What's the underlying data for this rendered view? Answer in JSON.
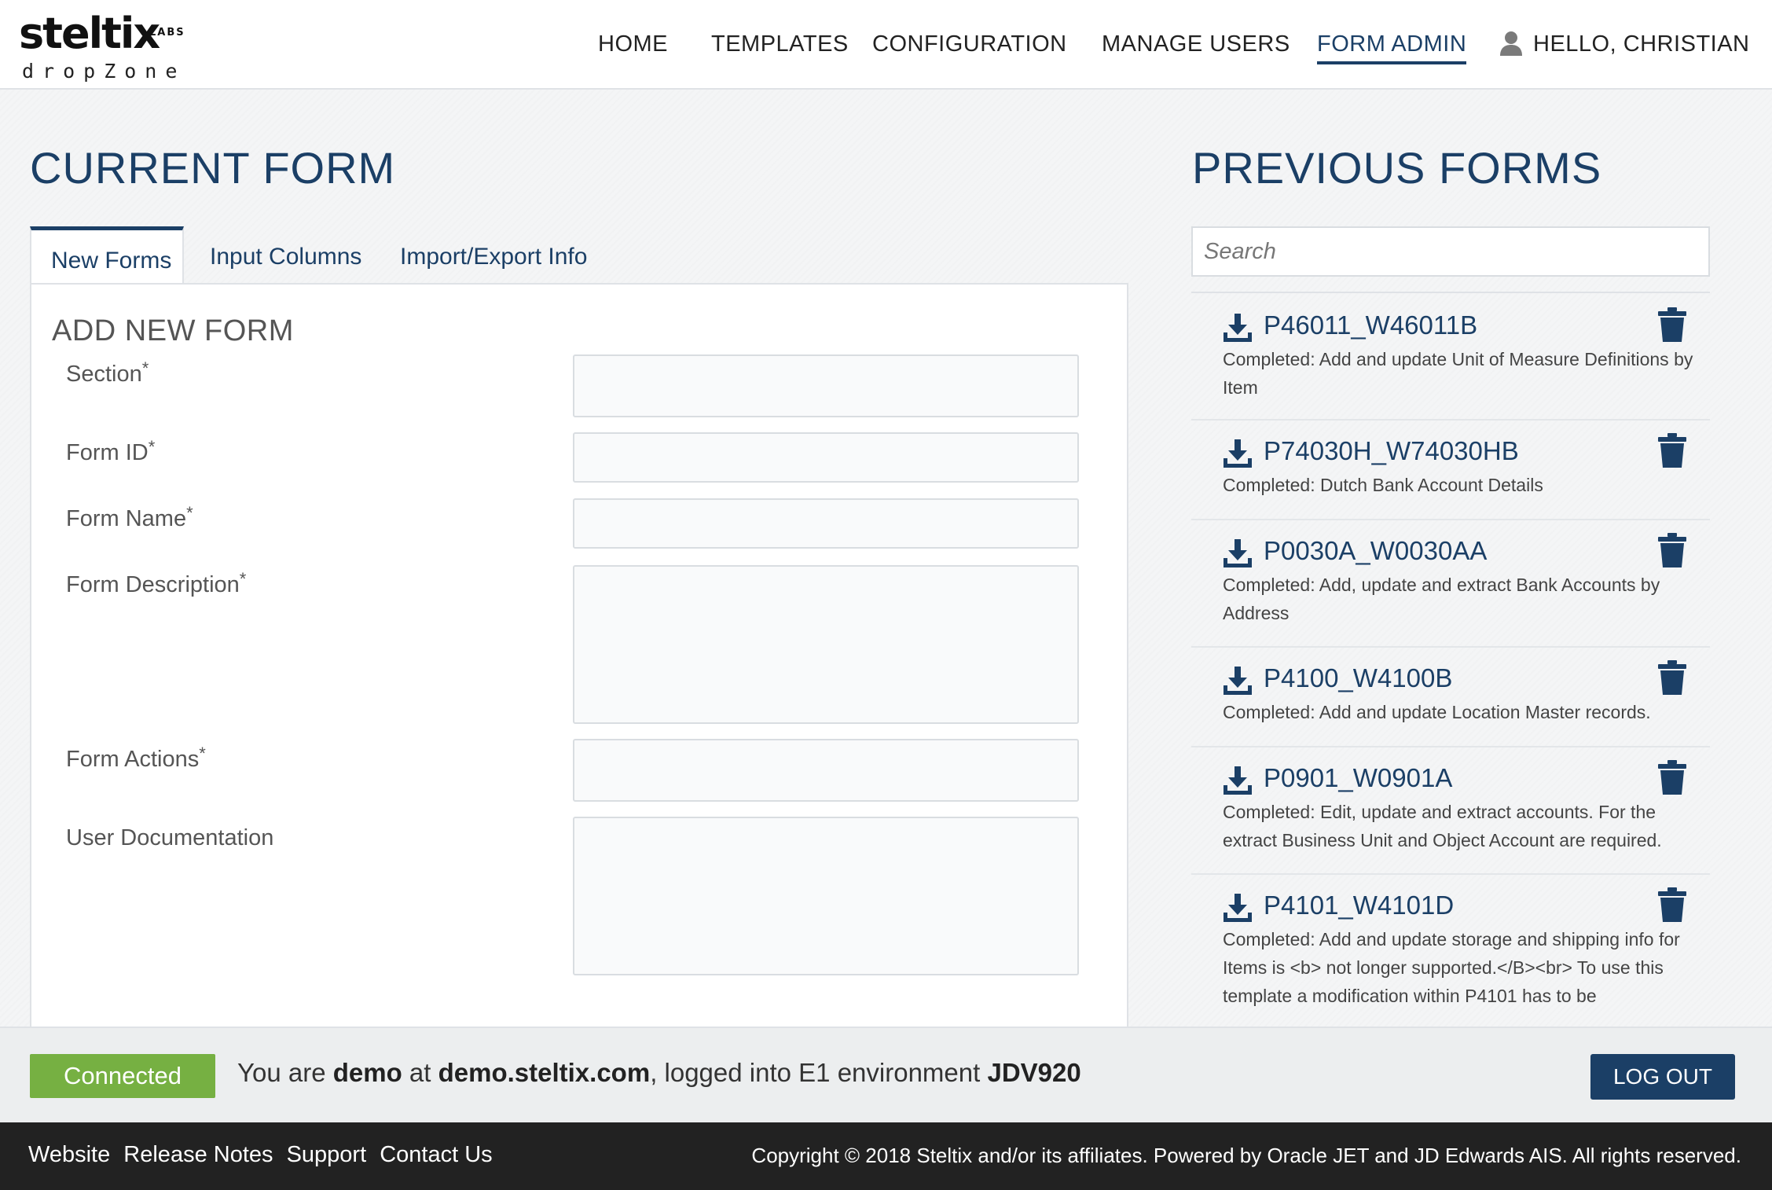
{
  "header": {
    "logo_main": "steltix",
    "logo_labs": "LABS",
    "logo_sub": "dropZone",
    "nav": [
      {
        "label": "HOME"
      },
      {
        "label": "TEMPLATES"
      },
      {
        "label": "CONFIGURATION"
      },
      {
        "label": "MANAGE USERS"
      },
      {
        "label": "FORM ADMIN",
        "active": true
      }
    ],
    "greeting": "HELLO, CHRISTIAN"
  },
  "current_form": {
    "heading": "CURRENT FORM",
    "tabs": [
      {
        "label": "New Forms",
        "active": true
      },
      {
        "label": "Input Columns"
      },
      {
        "label": "Import/Export Info"
      }
    ],
    "panel_title": "ADD NEW FORM",
    "required_marker": "*",
    "fields": [
      {
        "label": "Section",
        "required": true,
        "value": ""
      },
      {
        "label": "Form ID",
        "required": true,
        "value": ""
      },
      {
        "label": "Form Name",
        "required": true,
        "value": ""
      },
      {
        "label": "Form Description",
        "required": true,
        "value": ""
      },
      {
        "label": "Form Actions",
        "required": true,
        "value": ""
      },
      {
        "label": "User Documentation",
        "required": false,
        "value": ""
      }
    ]
  },
  "previous_forms": {
    "heading": "PREVIOUS FORMS",
    "search_placeholder": "Search",
    "items": [
      {
        "title": "P46011_W46011B",
        "desc": "Completed: Add and update Unit of Measure Definitions by Item"
      },
      {
        "title": "P74030H_W74030HB",
        "desc": "Completed: Dutch Bank Account Details"
      },
      {
        "title": "P0030A_W0030AA",
        "desc": "Completed: Add, update and extract Bank Accounts by Address"
      },
      {
        "title": "P4100_W4100B",
        "desc": "Completed: Add and update Location Master records."
      },
      {
        "title": "P0901_W0901A",
        "desc": "Completed: Edit, update and extract accounts. For the extract Business Unit and Object Account are required."
      },
      {
        "title": "P4101_W4101D",
        "desc": "Completed: Add and update storage and shipping info for Items is <b> not longer supported.</B><br> To use this template a modification within P4101 has to be"
      }
    ]
  },
  "status": {
    "badge": "Connected",
    "prefix": "You are ",
    "user": "demo",
    "at": " at ",
    "host": "demo.steltix.com",
    "middle": ", logged into E1 environment ",
    "env": "JDV920",
    "logout": "LOG OUT"
  },
  "footer": {
    "links": [
      "Website",
      "Release Notes",
      "Support",
      "Contact Us"
    ],
    "copyright": "Copyright © 2018 Steltix and/or its affiliates. Powered by Oracle JET and JD Edwards AIS. All rights reserved."
  },
  "colors": {
    "brand_blue": "#1b3f66",
    "connected_green": "#76b042",
    "footer_bg": "#222222"
  },
  "icons": [
    "user-icon",
    "download-icon",
    "trash-icon"
  ]
}
